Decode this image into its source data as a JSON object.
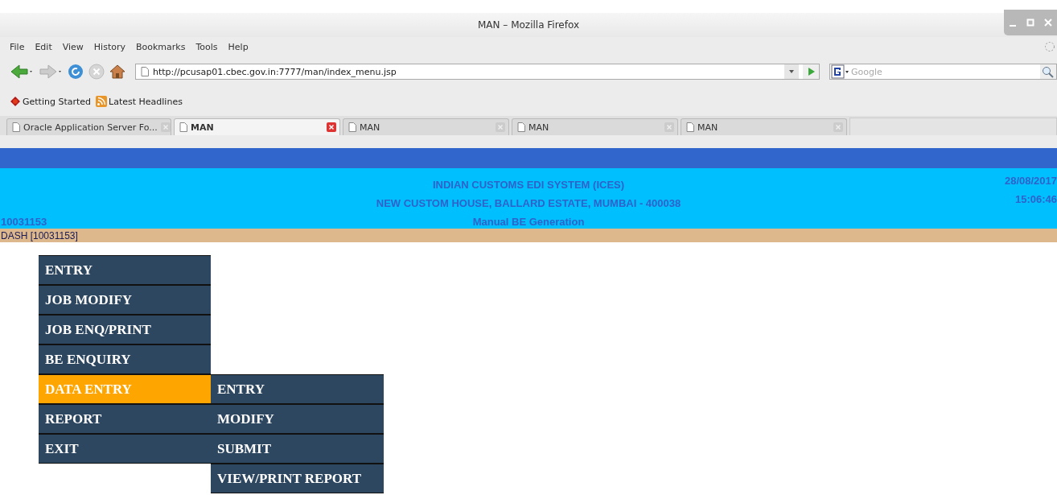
{
  "window": {
    "title": "MAN – Mozilla Firefox"
  },
  "menu_bar": [
    {
      "label": "File"
    },
    {
      "label": "Edit"
    },
    {
      "label": "View"
    },
    {
      "label": "History"
    },
    {
      "label": "Bookmarks"
    },
    {
      "label": "Tools"
    },
    {
      "label": "Help"
    }
  ],
  "address_bar": {
    "value": "http://pcusap01.cbec.gov.in:7777/man/index_menu.jsp"
  },
  "search": {
    "placeholder": "Google"
  },
  "bookmarks": [
    {
      "label": "Getting Started",
      "kind": "page"
    },
    {
      "label": "Latest Headlines",
      "kind": "feed"
    }
  ],
  "tabs": [
    {
      "label": "Oracle Application Server Fo...",
      "selected": false
    },
    {
      "label": "MAN",
      "selected": true
    },
    {
      "label": "MAN",
      "selected": false
    },
    {
      "label": "MAN",
      "selected": false
    },
    {
      "label": "MAN",
      "selected": false
    }
  ],
  "header": {
    "title_lines": [
      "INDIAN CUSTOMS EDI SYSTEM (ICES)",
      "NEW CUSTOM HOUSE, BALLARD ESTATE, MUMBAI - 400038",
      "Manual BE Generation"
    ],
    "user_id": "10031153",
    "date": "28/08/2017",
    "time": "15:06:46",
    "user_bar": "DASH [10031153]"
  },
  "menu": [
    {
      "label": "ENTRY",
      "selected": false
    },
    {
      "label": "JOB MODIFY",
      "selected": false
    },
    {
      "label": "JOB ENQ/PRINT",
      "selected": false
    },
    {
      "label": "BE ENQUIRY",
      "selected": false
    },
    {
      "label": "DATA ENTRY",
      "selected": true,
      "children": [
        {
          "label": "ENTRY"
        },
        {
          "label": "MODIFY"
        },
        {
          "label": "SUBMIT"
        },
        {
          "label": "VIEW/PRINT REPORT"
        }
      ]
    },
    {
      "label": "REPORT",
      "selected": false
    },
    {
      "label": "EXIT",
      "selected": false
    }
  ]
}
